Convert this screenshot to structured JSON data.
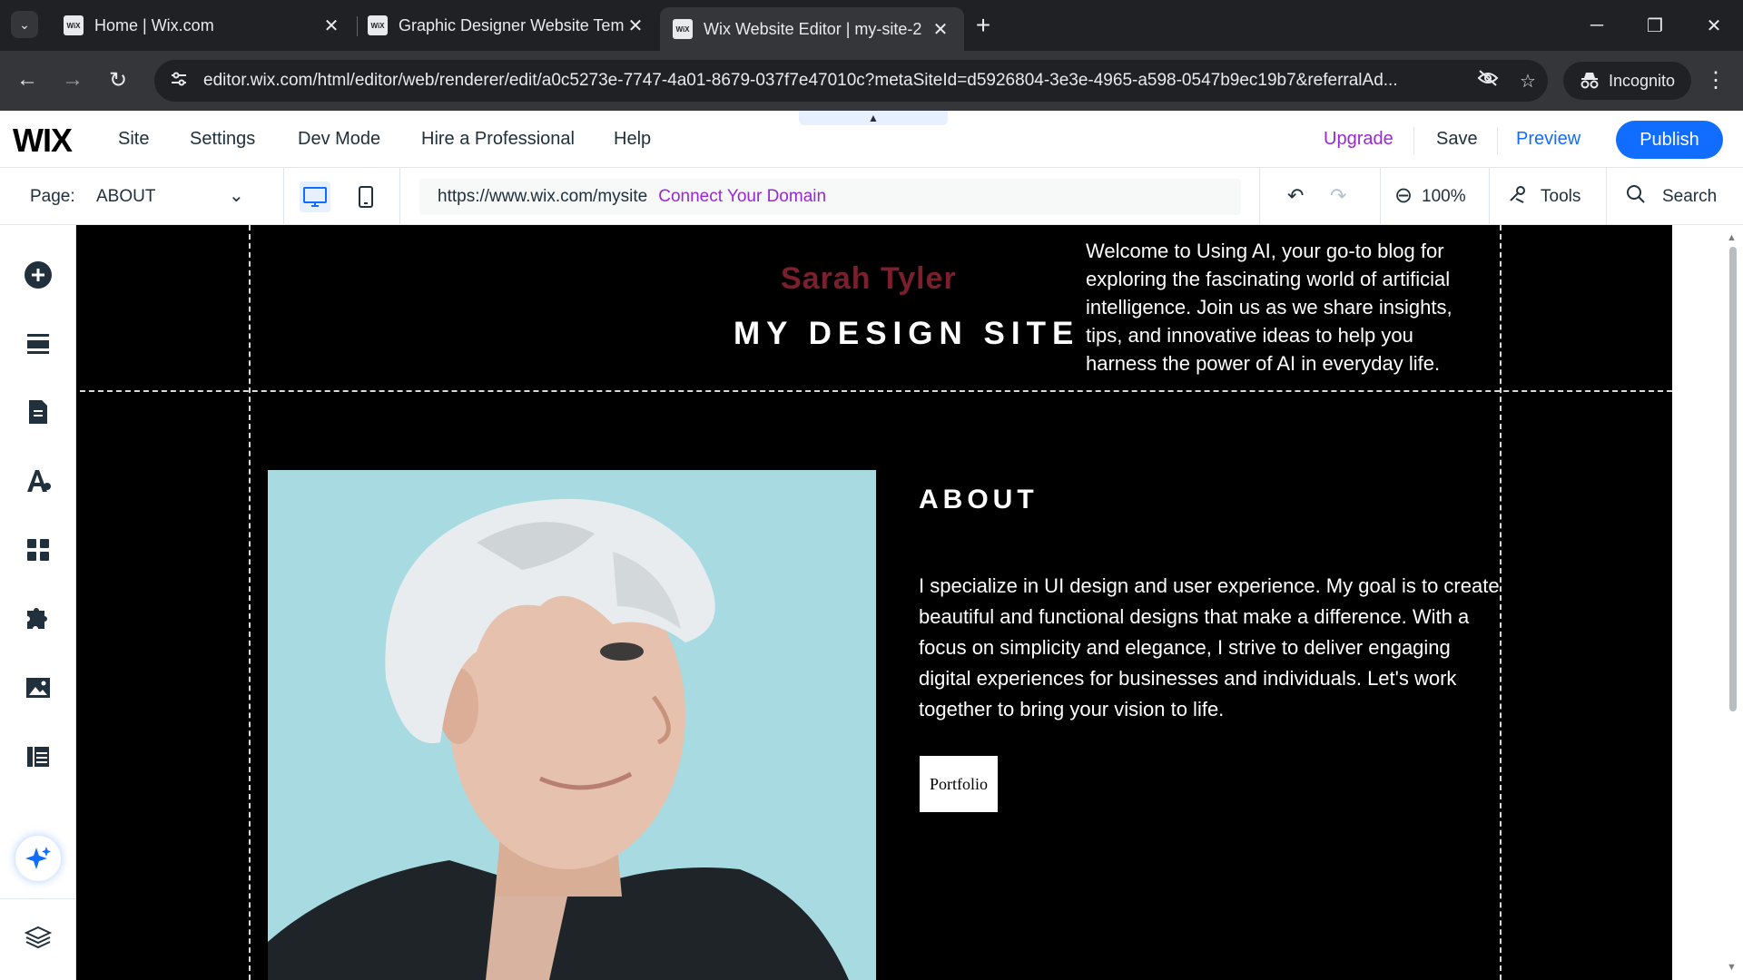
{
  "browser": {
    "tabs": [
      {
        "title": "Home | Wix.com",
        "favicon": "WiX",
        "active": false
      },
      {
        "title": "Graphic Designer Website Temp",
        "favicon": "WiX",
        "active": false
      },
      {
        "title": "Wix Website Editor | my-site-2",
        "favicon": "WiX",
        "active": true
      }
    ],
    "url": "editor.wix.com/html/editor/web/renderer/edit/a0c5273e-7747-4a01-8679-037f7e47010c?metaSiteId=d5926804-3e3e-4965-a598-0547b9ec19b7&referralAd...",
    "incognito_label": "Incognito"
  },
  "editor": {
    "logo": "WIX",
    "menu": [
      "Site",
      "Settings",
      "Dev Mode",
      "Hire a Professional",
      "Help"
    ],
    "upgrade": "Upgrade",
    "save": "Save",
    "preview": "Preview",
    "publish": "Publish",
    "page_label": "Page:",
    "page_name": "ABOUT",
    "site_url": "https://www.wix.com/mysite",
    "connect_domain": "Connect Your Domain",
    "zoom": "100%",
    "tools": "Tools",
    "search": "Search"
  },
  "site": {
    "owner_name": "Sarah Tyler",
    "site_title": "MY DESIGN SITE",
    "welcome_text": "Welcome to Using AI, your go-to blog for exploring the fascinating world of artificial intelligence. Join us as we share insights, tips, and innovative ideas to help you harness the power of AI in everyday life.",
    "about_heading": "ABOUT",
    "about_text": "I specialize in UI design and user experience. My goal is to create beautiful and functional designs that make a difference. With a focus on simplicity and elegance, I strive to deliver engaging digital experiences for businesses and individuals. Let's work together to bring your vision to life.",
    "portfolio_button": "Portfolio"
  },
  "colors": {
    "wix_blue": "#116dff",
    "upgrade_purple": "#9a27d5",
    "owner_name": "#7a1f2b",
    "canvas_bg": "#000000"
  }
}
